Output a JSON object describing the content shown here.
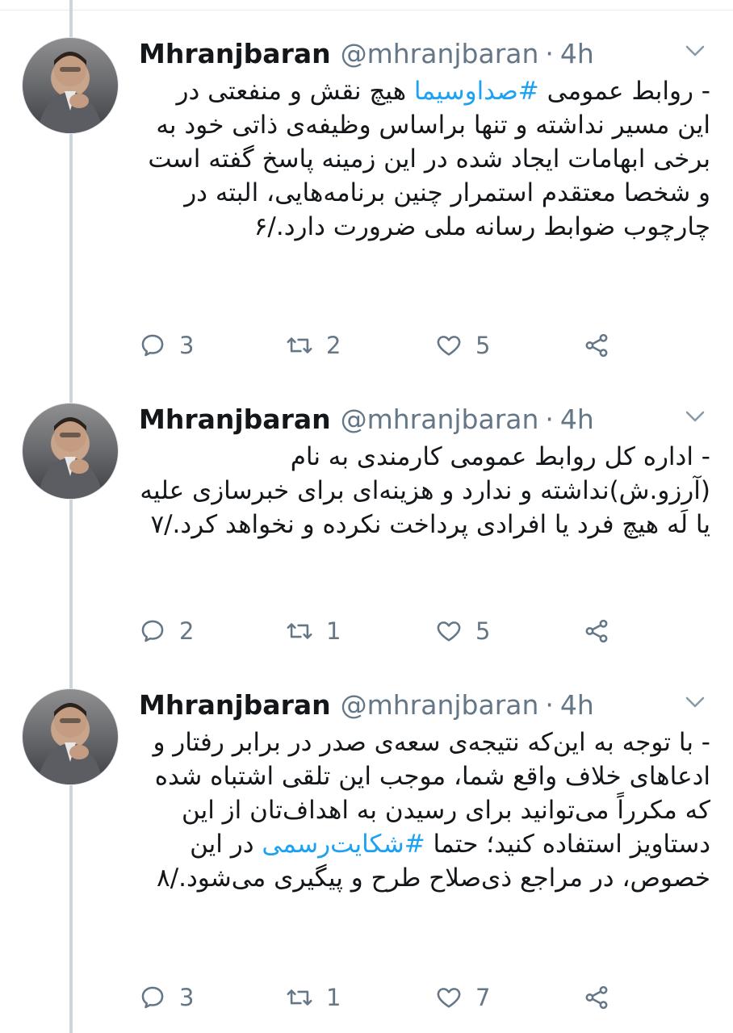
{
  "tweets": [
    {
      "name": "Mhranjbaran",
      "handle": "@mhranjbaran",
      "separator": "·",
      "time": "4h",
      "prefix": "- روابط عمومی ",
      "hashtag": "#صداوسیما",
      "text": " هیچ نقش و منفعتی در این مسیر نداشته و تنها براساس وظیفه‌ی ذاتی خود به برخی ابهامات ایجاد شده در این زمینه پاسخ گفته است و شخصا معتقدم استمرار چنین برنامه‌هایی، البته در چارچوب ضوابط رسانه ملی ضرورت دارد./۶",
      "suffix": "",
      "replies": "3",
      "retweets": "2",
      "likes": "5"
    },
    {
      "name": "Mhranjbaran",
      "handle": "@mhranjbaran",
      "separator": "·",
      "time": "4h",
      "prefix": "- اداره کل روابط عمومی کارمندی به نام (آرزو.ش)نداشته و ندارد و هزینه‌ای برای خبرسازی علیه یا لَه هیچ فرد یا افرادی پرداخت نکرده و نخواهد کرد./۷",
      "hashtag": "",
      "text": "",
      "suffix": "",
      "replies": "2",
      "retweets": "1",
      "likes": "5"
    },
    {
      "name": "Mhranjbaran",
      "handle": "@mhranjbaran",
      "separator": "·",
      "time": "4h",
      "prefix": "- با توجه به این‌که نتیجه‌ی سعه‌ی صدر در برابر رفتار و ادعاهای خلاف واقع شما، موجب این تلقی اشتباه شده که مکرراً می‌توانید برای رسیدن به اهداف‌تان از این دستاویز استفاده کنید؛ حتما ",
      "hashtag": "#شکایت‌رسمی",
      "text": " در این خصوص، در مراجع ذی‌صلاح طرح و پیگیری می‌شود./۸",
      "suffix": "",
      "replies": "3",
      "retweets": "1",
      "likes": "7"
    }
  ],
  "icons": {
    "reply": "reply-icon",
    "retweet": "retweet-icon",
    "like": "heart-icon",
    "share": "share-icon",
    "menu": "chevron-down-icon"
  },
  "colors": {
    "hashtag": "#1da1f2",
    "secondary_text": "#657786",
    "thread_line": "#ccd6dd"
  }
}
